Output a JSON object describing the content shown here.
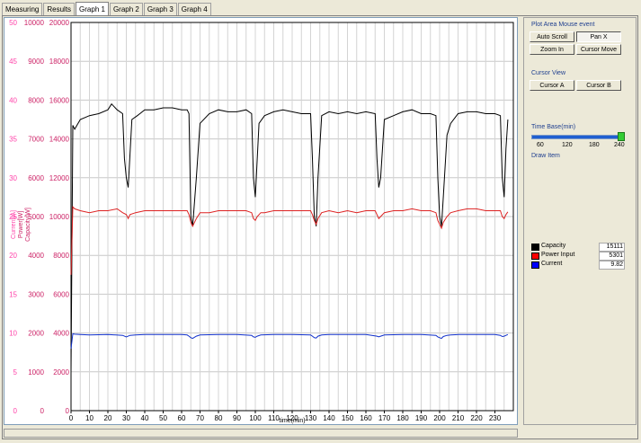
{
  "tabs": [
    "Measuring",
    "Results",
    "Graph 1",
    "Graph 2",
    "Graph 3",
    "Graph 4"
  ],
  "active_tab": "Graph 1",
  "panel": {
    "mouse_event_title": "Plot Area Mouse event",
    "auto_scroll": "Auto Scroll",
    "pan_x": "Pan X",
    "zoom_in": "Zoom In",
    "cursor_move": "Cursor Move",
    "cursor_view_title": "Cursor View",
    "cursor_a": "Cursor A",
    "cursor_b": "Cursor B",
    "time_base_title": "Time Base(min)",
    "time_base_ticks": [
      "60",
      "120",
      "180",
      "240"
    ],
    "time_base_value": 240,
    "draw_item_title": "Draw Item"
  },
  "legend": [
    {
      "name": "Capacity",
      "value": "15111",
      "color": "#000000"
    },
    {
      "name": "Power Input",
      "value": "5301",
      "color": "#ff0000"
    },
    {
      "name": "Current",
      "value": "9.82",
      "color": "#0000ff"
    }
  ],
  "colors": {
    "current_axis": "#ff44aa",
    "power_axis": "#cc2266",
    "capacity": "#000000",
    "power": "#dd2222",
    "current": "#1030cc"
  },
  "chart_data": {
    "type": "line",
    "xlabel": "time(min)",
    "xlim": [
      0,
      240
    ],
    "x_ticks": [
      "0",
      "10",
      "20",
      "30",
      "40",
      "50",
      "60",
      "70",
      "80",
      "90",
      "100",
      "110",
      "120",
      "130",
      "140",
      "150",
      "160",
      "170",
      "180",
      "190",
      "200",
      "210",
      "220",
      "230"
    ],
    "y_axes": [
      {
        "label": "Current[A]",
        "lim": [
          0,
          50
        ],
        "ticks": [
          "0",
          "5",
          "10",
          "15",
          "20",
          "25",
          "30",
          "35",
          "40",
          "45",
          "50"
        ]
      },
      {
        "label": "Power[W]",
        "lim": [
          0,
          10000
        ],
        "ticks": [
          "0",
          "1000",
          "2000",
          "3000",
          "4000",
          "5000",
          "6000",
          "7000",
          "8000",
          "9000",
          "10000"
        ]
      },
      {
        "label": "Capacity[W]",
        "lim": [
          0,
          20000
        ],
        "ticks": [
          "0",
          "2000",
          "4000",
          "6000",
          "8000",
          "10000",
          "12000",
          "14000",
          "16000",
          "18000",
          "20000"
        ]
      }
    ],
    "grid": true,
    "series": [
      {
        "name": "Capacity",
        "axis": 2,
        "x": [
          0,
          1,
          2,
          5,
          10,
          15,
          20,
          22,
          25,
          28,
          29,
          30,
          31,
          33,
          36,
          40,
          45,
          50,
          55,
          60,
          63,
          64,
          65,
          66,
          68,
          70,
          75,
          80,
          85,
          90,
          95,
          98,
          99,
          100,
          102,
          105,
          110,
          115,
          120,
          125,
          130,
          131,
          132,
          133,
          134,
          136,
          140,
          145,
          150,
          155,
          160,
          165,
          166,
          167,
          168,
          170,
          175,
          180,
          185,
          190,
          195,
          198,
          199,
          200,
          201,
          202,
          204,
          206,
          210,
          215,
          220,
          225,
          230,
          233,
          234,
          235,
          236,
          237
        ],
        "y": [
          2000,
          14700,
          14500,
          15000,
          15200,
          15300,
          15500,
          15800,
          15500,
          15300,
          13000,
          12000,
          11500,
          15000,
          15200,
          15500,
          15500,
          15600,
          15600,
          15500,
          15500,
          15300,
          10000,
          9500,
          12000,
          14800,
          15300,
          15500,
          15400,
          15400,
          15500,
          15300,
          12000,
          11000,
          14800,
          15200,
          15400,
          15500,
          15400,
          15300,
          15300,
          13000,
          10000,
          9500,
          12000,
          15200,
          15400,
          15300,
          15400,
          15300,
          15400,
          15300,
          13000,
          11500,
          12000,
          15000,
          15200,
          15400,
          15500,
          15300,
          15300,
          15200,
          12000,
          10000,
          9500,
          11000,
          14200,
          14800,
          15300,
          15400,
          15400,
          15300,
          15300,
          15200,
          12000,
          11000,
          13500,
          15000
        ]
      },
      {
        "name": "Power Input",
        "axis": 1,
        "x": [
          0,
          1,
          2,
          5,
          10,
          15,
          20,
          25,
          28,
          30,
          31,
          32,
          35,
          40,
          45,
          50,
          55,
          60,
          63,
          64,
          65,
          66,
          68,
          70,
          75,
          80,
          85,
          90,
          95,
          98,
          99,
          100,
          101,
          103,
          105,
          110,
          115,
          120,
          125,
          130,
          131,
          132,
          133,
          134,
          136,
          140,
          145,
          150,
          155,
          160,
          165,
          166,
          167,
          168,
          170,
          175,
          180,
          185,
          190,
          195,
          198,
          199,
          200,
          201,
          202,
          204,
          206,
          210,
          215,
          220,
          225,
          230,
          233,
          234,
          235,
          236,
          237
        ],
        "y": [
          3500,
          5250,
          5200,
          5150,
          5100,
          5150,
          5150,
          5200,
          5100,
          5050,
          4950,
          5050,
          5100,
          5150,
          5150,
          5150,
          5150,
          5150,
          5150,
          5050,
          4850,
          4750,
          4950,
          5100,
          5100,
          5150,
          5150,
          5150,
          5150,
          5100,
          4950,
          4900,
          5000,
          5100,
          5100,
          5150,
          5150,
          5150,
          5150,
          5150,
          5050,
          4900,
          4800,
          4950,
          5100,
          5150,
          5100,
          5150,
          5100,
          5150,
          5150,
          5050,
          4950,
          5000,
          5100,
          5150,
          5150,
          5200,
          5150,
          5150,
          5100,
          4900,
          4800,
          4700,
          4850,
          5000,
          5100,
          5150,
          5200,
          5200,
          5150,
          5150,
          5150,
          5000,
          4950,
          5050,
          5120
        ]
      },
      {
        "name": "Current",
        "axis": 0,
        "x": [
          0,
          1,
          2,
          5,
          10,
          20,
          28,
          30,
          32,
          35,
          40,
          50,
          60,
          63,
          64,
          65,
          66,
          68,
          70,
          80,
          90,
          98,
          99,
          100,
          101,
          103,
          110,
          120,
          130,
          131,
          132,
          133,
          134,
          136,
          140,
          150,
          160,
          166,
          167,
          168,
          170,
          180,
          190,
          198,
          199,
          200,
          201,
          202,
          204,
          206,
          210,
          220,
          230,
          233,
          234,
          235,
          236,
          237
        ],
        "y": [
          8,
          9.9,
          9.85,
          9.8,
          9.75,
          9.8,
          9.7,
          9.5,
          9.7,
          9.75,
          9.8,
          9.8,
          9.8,
          9.75,
          9.6,
          9.4,
          9.3,
          9.6,
          9.75,
          9.8,
          9.8,
          9.7,
          9.5,
          9.45,
          9.6,
          9.75,
          9.8,
          9.8,
          9.75,
          9.6,
          9.4,
          9.35,
          9.6,
          9.75,
          9.8,
          9.8,
          9.8,
          9.6,
          9.5,
          9.6,
          9.75,
          9.8,
          9.8,
          9.7,
          9.5,
          9.4,
          9.3,
          9.55,
          9.7,
          9.75,
          9.8,
          9.8,
          9.8,
          9.7,
          9.55,
          9.6,
          9.7,
          9.8
        ]
      }
    ]
  }
}
